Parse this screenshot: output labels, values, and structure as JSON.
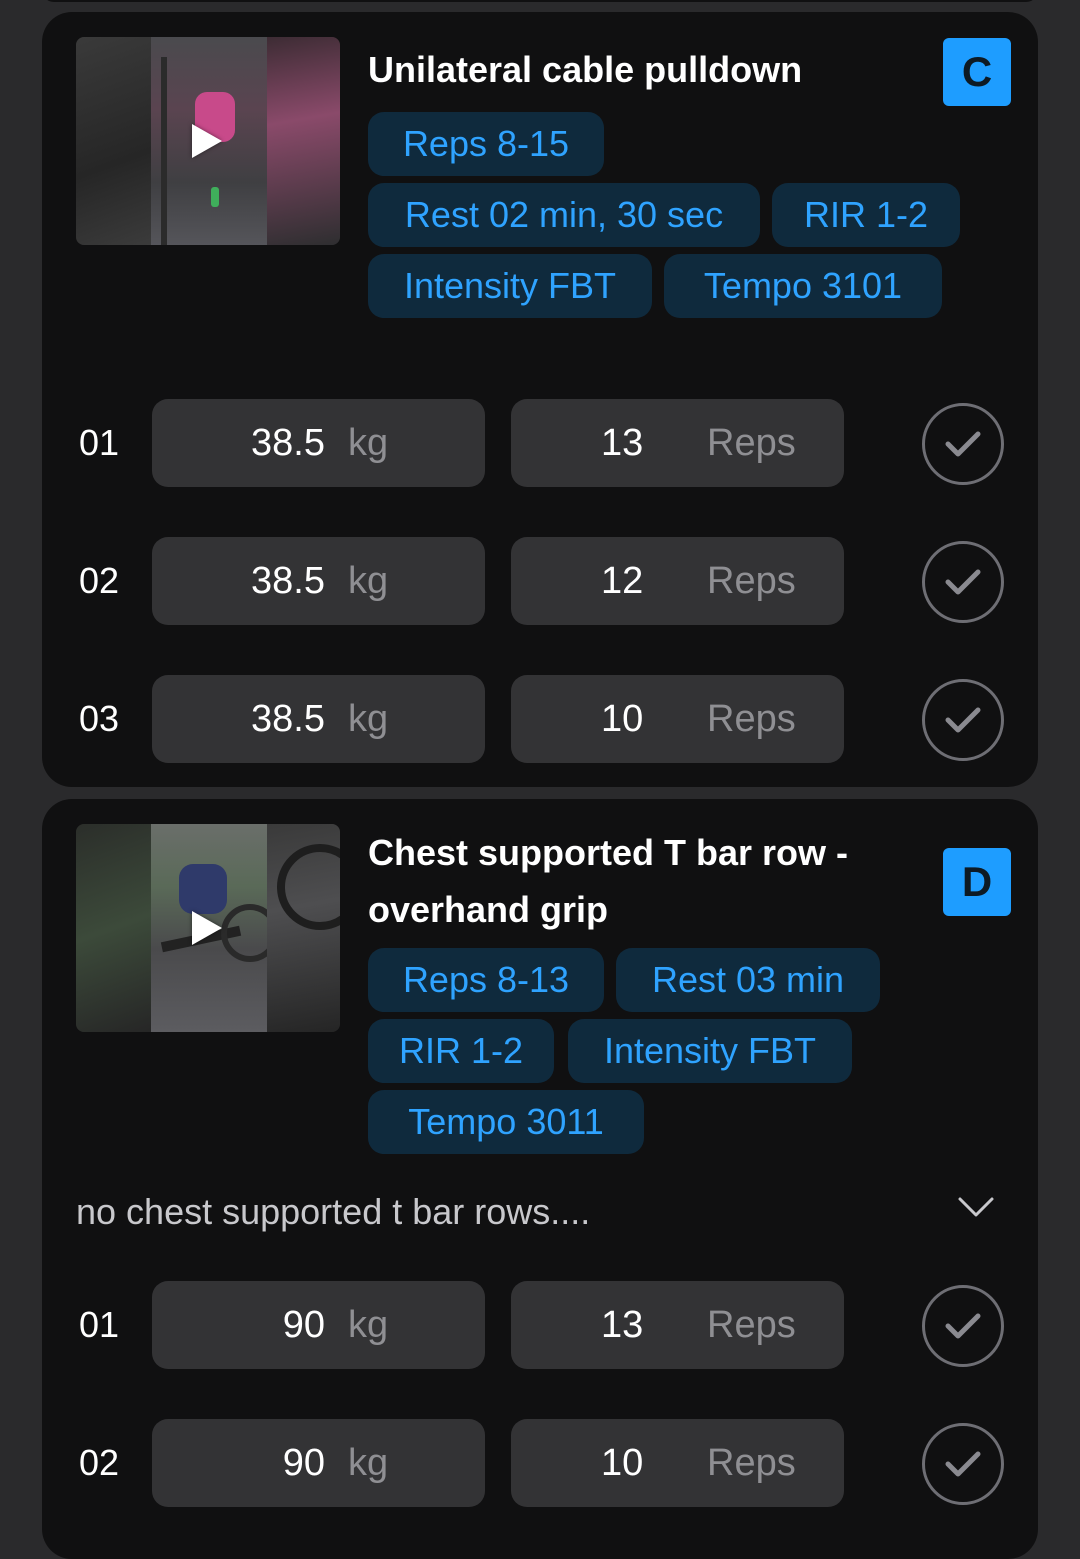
{
  "exercises": [
    {
      "title": "Unilateral cable pulldown",
      "badge": "C",
      "tags": [
        "Reps 8-15",
        "Rest 02 min, 30 sec",
        "RIR 1-2",
        "Intensity FBT",
        "Tempo 3101"
      ],
      "sets": [
        {
          "num": "01",
          "weight": "38.5",
          "weight_unit": "kg",
          "reps": "13",
          "reps_unit": "Reps"
        },
        {
          "num": "02",
          "weight": "38.5",
          "weight_unit": "kg",
          "reps": "12",
          "reps_unit": "Reps"
        },
        {
          "num": "03",
          "weight": "38.5",
          "weight_unit": "kg",
          "reps": "10",
          "reps_unit": "Reps"
        }
      ]
    },
    {
      "title_line1": "Chest supported T bar row -",
      "title_line2": "overhand grip",
      "badge": "D",
      "tags": [
        "Reps 8-13",
        "Rest 03 min",
        "RIR 1-2",
        "Intensity FBT",
        "Tempo 3011"
      ],
      "note": "no chest supported t bar rows....",
      "sets": [
        {
          "num": "01",
          "weight": "90",
          "weight_unit": "kg",
          "reps": "13",
          "reps_unit": "Reps"
        },
        {
          "num": "02",
          "weight": "90",
          "weight_unit": "kg",
          "reps": "10",
          "reps_unit": "Reps"
        }
      ]
    }
  ],
  "colors": {
    "background": "#2a2a2c",
    "card": "#101011",
    "badge": "#1e9dff",
    "tag_bg": "#0f2a3d",
    "tag_text": "#2fa3ff",
    "field": "#333335"
  },
  "icons": {
    "play": "play-icon",
    "check": "check-icon",
    "chevron": "chevron-down-icon"
  }
}
